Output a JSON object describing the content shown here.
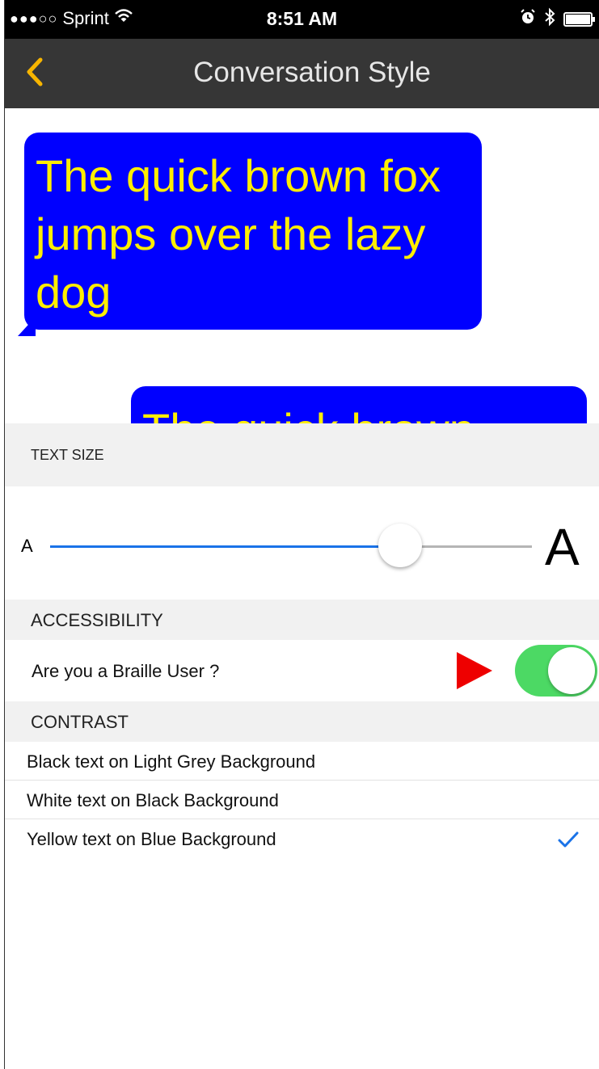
{
  "status_bar": {
    "signal": "●●●○○",
    "carrier": "Sprint",
    "wifi_icon": "wifi-icon",
    "time": "8:51 AM",
    "alarm_icon": "alarm-icon",
    "bluetooth_icon": "bluetooth-icon",
    "battery_icon": "battery-icon"
  },
  "nav": {
    "back_icon": "chevron-left-icon",
    "back_glyph": "<",
    "title": "Conversation Style",
    "accent_color": "#f7b500"
  },
  "preview": {
    "incoming_text": "The quick brown fox jumps over the lazy dog",
    "outgoing_text": "The quick brown",
    "bubble_bg": "#0000ff",
    "bubble_fg": "#ffee00"
  },
  "text_size": {
    "header": "TEXT SIZE",
    "small_label": "A",
    "large_label": "A",
    "slider_fraction": 0.7
  },
  "accessibility": {
    "header": "ACCESSIBILITY",
    "braille_label": "Are you a Braille User ?",
    "braille_enabled": true,
    "toggle_color": "#4cd964"
  },
  "contrast": {
    "header": "CONTRAST",
    "options": [
      {
        "label": "Black text on Light Grey Background",
        "selected": false
      },
      {
        "label": "White text on Black Background",
        "selected": false
      },
      {
        "label": "Yellow text on Blue Background",
        "selected": true
      }
    ],
    "check_icon": "checkmark-icon",
    "check_color": "#1a73e8"
  }
}
